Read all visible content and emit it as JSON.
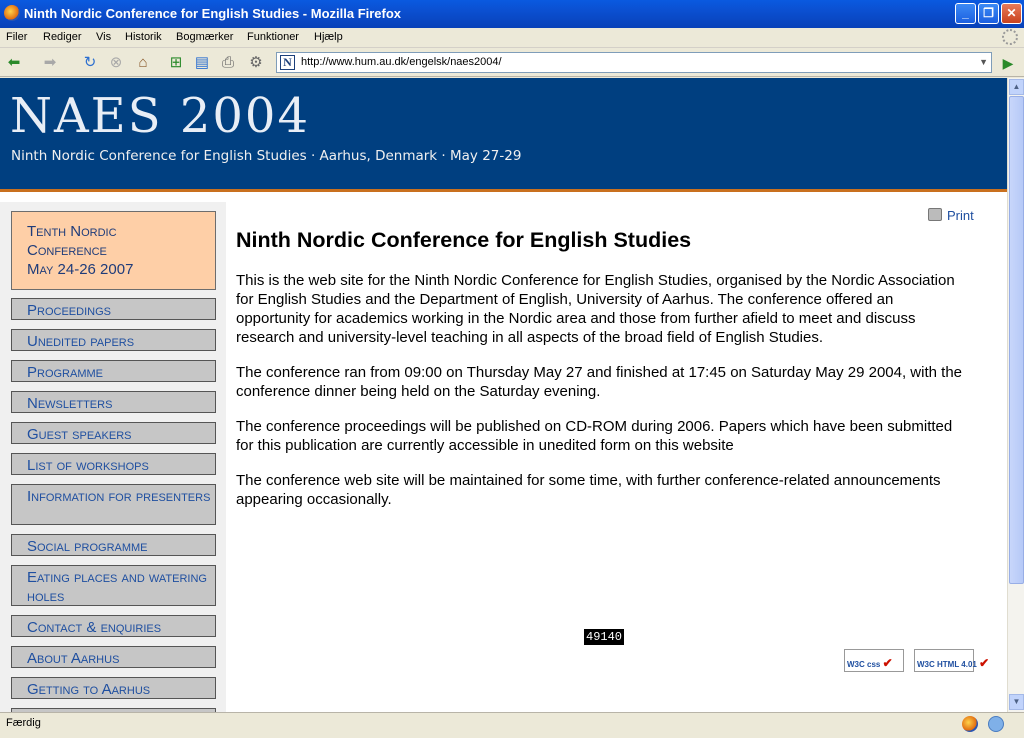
{
  "window": {
    "title": "Ninth Nordic Conference for English Studies - Mozilla Firefox",
    "minimize": "_",
    "restore": "❐",
    "close": "✕"
  },
  "menu": [
    "Filer",
    "Rediger",
    "Vis",
    "Historik",
    "Bogmærker",
    "Funktioner",
    "Hjælp"
  ],
  "toolbar": {
    "url": "http://www.hum.au.dk/engelsk/naes2004/",
    "favicon_letter": "N"
  },
  "banner": {
    "title": "NAES 2004",
    "subtitle": "Ninth Nordic Conference for English Studies · Aarhus, Denmark · May 27-29"
  },
  "sidebar": {
    "promo": [
      "Tenth Nordic",
      "Conference",
      "May 24-26 2007"
    ],
    "items": [
      "Proceedings",
      "Unedited papers",
      "Programme",
      "Newsletters",
      "Guest speakers",
      "List of workshops",
      "Information for presenters",
      "Social programme",
      "Eating places and watering holes",
      "Contact & enquiries",
      "About Aarhus",
      "Getting to Aarhus"
    ]
  },
  "content": {
    "print_label": "Print",
    "heading": "Ninth Nordic Conference for English Studies",
    "paragraphs": [
      "This is the web site for the Ninth Nordic Conference for English Studies, organised by the Nordic Association for English Studies and the Department of English, University of Aarhus. The conference offered an opportunity for academics working in the Nordic area and those from further afield to meet and discuss research and university-level teaching in all aspects of the broad field of English Studies.",
      "The conference ran from 09:00 on Thursday May 27 and finished at 17:45 on Saturday May 29 2004, with the conference dinner being held on the Saturday evening.",
      "The conference proceedings will be published on CD-ROM during 2006. Papers which have been submitted for this publication are currently accessible in unedited form on this website",
      "The conference web site will be maintained for some time, with further conference-related announcements appearing occasionally."
    ],
    "badges": [
      "W3C css",
      "W3C HTML 4.01"
    ],
    "counter": "49140"
  },
  "status": {
    "text": "Færdig"
  },
  "colors": {
    "banner_bg": "#003f80",
    "banner_rule": "#c9701e",
    "promo_bg": "#fecfa7",
    "nav_bg": "#c6c6c6",
    "link": "#1f4fa0"
  }
}
